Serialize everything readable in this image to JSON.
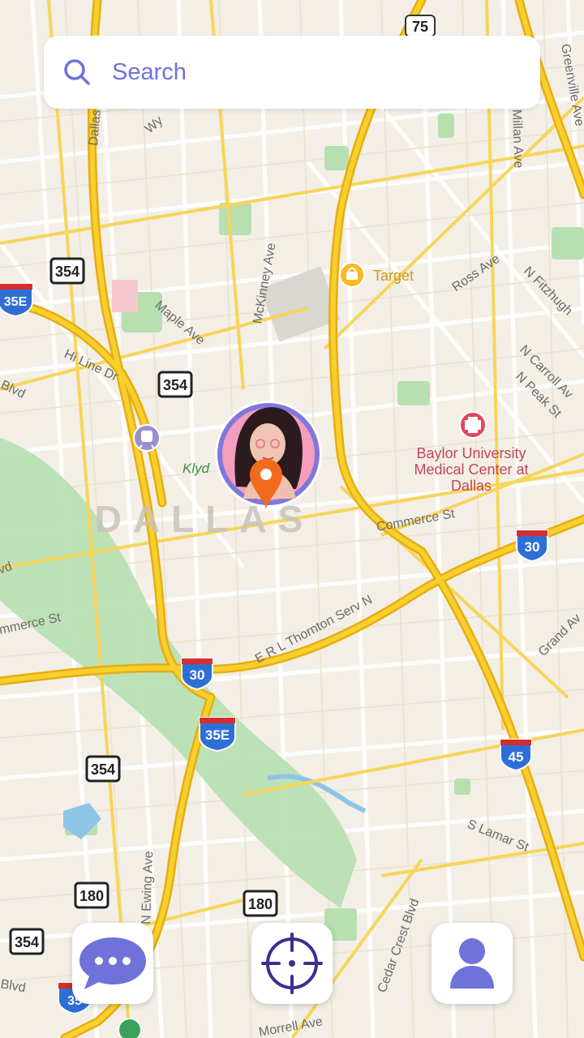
{
  "search": {
    "placeholder": "Search"
  },
  "map": {
    "city_label": "DALLAS",
    "poi": {
      "target": "Target",
      "baylor_line1": "Baylor University",
      "baylor_line2": "Medical Center at",
      "baylor_line3": "Dallas",
      "klyde": "Klyd"
    },
    "streets": {
      "maple_ave": "Maple Ave",
      "mckinney_ave": "McKinney Ave",
      "ross_ave": "Ross Ave",
      "n_fitzhugh": "N Fitzhugh",
      "n_carroll_av": "N Carroll Av",
      "n_peak_st": "N Peak St",
      "hi_line_dr": "Hi Line Dr",
      "commerce_st": "Commerce St",
      "commerce_st_left": "mmerce St",
      "erl_thornton": "E R L Thornton Serv N",
      "grand_av": "Grand Av",
      "s_lamar_st": "S Lamar St",
      "cedar_crest_blvd": "Cedar Crest Blvd",
      "n_ewing_ave": "N Ewing Ave",
      "morrell_ave": "Morrell Ave",
      "greenville_ave": "Greenville Ave",
      "millan_ave": "Millan Ave",
      "wy": "Wy",
      "dallas_pkwy": "Dallas N Tollway",
      "blvd_left": "Blvd",
      "blvd_bottom": "Blvd",
      "vd_left": "vd"
    },
    "route_shields": {
      "r75": "75",
      "r354_a": "354",
      "r354_b": "354",
      "r354_c": "354",
      "r354_d": "354",
      "r180_a": "180",
      "r180_b": "180",
      "i35e_a": "35E",
      "i35e_b": "35E",
      "i35e_c": "35",
      "i30_a": "30",
      "i30_b": "30",
      "i45": "45"
    }
  },
  "colors": {
    "accent": "#6f72d9",
    "pin": "#f26a1b",
    "highway": "#f7c623",
    "park": "#9fd3a1",
    "land": "#f3efe6"
  },
  "icons": {
    "search": "search-icon",
    "chat": "chat-bubble-icon",
    "locate": "crosshair-icon",
    "profile": "person-icon",
    "pin": "location-pin-icon"
  }
}
